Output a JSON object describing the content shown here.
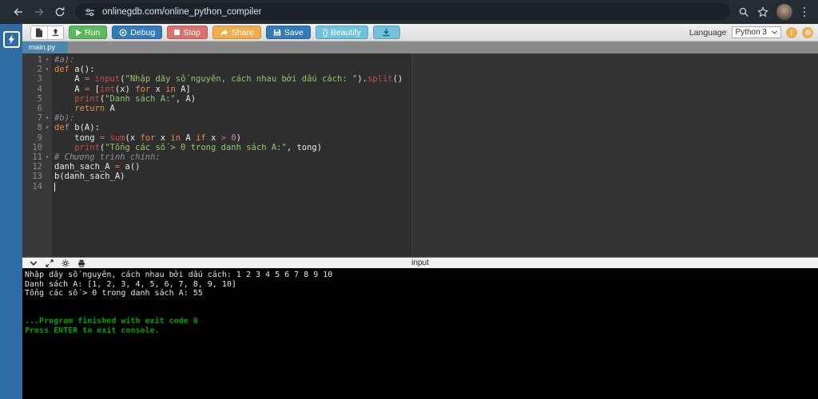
{
  "browser": {
    "url": "onlinegdb.com/online_python_compiler"
  },
  "toolbar": {
    "run_label": "Run",
    "debug_label": "Debug",
    "stop_label": "Stop",
    "share_label": "Share",
    "save_label": "Save",
    "beautify_label": "{} Beautify",
    "language_label": "Language",
    "language_value": "Python 3",
    "info_label": "i"
  },
  "tabbar": {
    "tabs": [
      {
        "label": "main.py",
        "active": true
      }
    ]
  },
  "editor": {
    "lines": [
      {
        "num": 1,
        "fold": true,
        "segments": [
          {
            "c": "com",
            "t": "#a):"
          }
        ]
      },
      {
        "num": 2,
        "fold": true,
        "segments": [
          {
            "c": "kw",
            "t": "def"
          },
          {
            "c": "pl",
            "t": " a():"
          }
        ]
      },
      {
        "num": 3,
        "segments": [
          {
            "c": "pl",
            "t": "    A "
          },
          {
            "c": "op",
            "t": "="
          },
          {
            "c": "pl",
            "t": " "
          },
          {
            "c": "fn",
            "t": "input"
          },
          {
            "c": "pl",
            "t": "("
          },
          {
            "c": "str",
            "t": "\"Nhập dãy số nguyên, cách nhau bởi dấu cách: \""
          },
          {
            "c": "pl",
            "t": ")."
          },
          {
            "c": "fn",
            "t": "split"
          },
          {
            "c": "pl",
            "t": "()"
          }
        ]
      },
      {
        "num": 4,
        "segments": [
          {
            "c": "pl",
            "t": "    A "
          },
          {
            "c": "op",
            "t": "="
          },
          {
            "c": "pl",
            "t": " ["
          },
          {
            "c": "fn",
            "t": "int"
          },
          {
            "c": "pl",
            "t": "(x) "
          },
          {
            "c": "kw",
            "t": "for"
          },
          {
            "c": "pl",
            "t": " x "
          },
          {
            "c": "kw",
            "t": "in"
          },
          {
            "c": "pl",
            "t": " A]"
          }
        ]
      },
      {
        "num": 5,
        "segments": [
          {
            "c": "pl",
            "t": "    "
          },
          {
            "c": "fn",
            "t": "print"
          },
          {
            "c": "pl",
            "t": "("
          },
          {
            "c": "str",
            "t": "\"Danh sách A:\""
          },
          {
            "c": "pl",
            "t": ", A)"
          }
        ]
      },
      {
        "num": 6,
        "segments": [
          {
            "c": "pl",
            "t": "    "
          },
          {
            "c": "kw",
            "t": "return"
          },
          {
            "c": "pl",
            "t": " A"
          }
        ]
      },
      {
        "num": 7,
        "fold": true,
        "segments": [
          {
            "c": "com",
            "t": "#b):"
          }
        ]
      },
      {
        "num": 8,
        "fold": true,
        "segments": [
          {
            "c": "kw",
            "t": "def"
          },
          {
            "c": "pl",
            "t": " b(A):"
          }
        ]
      },
      {
        "num": 9,
        "segments": [
          {
            "c": "pl",
            "t": "    tong "
          },
          {
            "c": "op",
            "t": "="
          },
          {
            "c": "pl",
            "t": " "
          },
          {
            "c": "fn",
            "t": "sum"
          },
          {
            "c": "pl",
            "t": "(x "
          },
          {
            "c": "kw",
            "t": "for"
          },
          {
            "c": "pl",
            "t": " x "
          },
          {
            "c": "kw",
            "t": "in"
          },
          {
            "c": "pl",
            "t": " A "
          },
          {
            "c": "kw",
            "t": "if"
          },
          {
            "c": "pl",
            "t": " x "
          },
          {
            "c": "op",
            "t": ">"
          },
          {
            "c": "pl",
            "t": " "
          },
          {
            "c": "num",
            "t": "0"
          },
          {
            "c": "pl",
            "t": ")"
          }
        ]
      },
      {
        "num": 10,
        "segments": [
          {
            "c": "pl",
            "t": "    "
          },
          {
            "c": "fn",
            "t": "print"
          },
          {
            "c": "pl",
            "t": "("
          },
          {
            "c": "str",
            "t": "\"Tổng các số > 0 trong danh sách A:\""
          },
          {
            "c": "pl",
            "t": ", tong)"
          }
        ]
      },
      {
        "num": 11,
        "fold": true,
        "segments": [
          {
            "c": "com",
            "t": "# Chương trình chính:"
          }
        ]
      },
      {
        "num": 12,
        "segments": [
          {
            "c": "pl",
            "t": "danh_sach_A "
          },
          {
            "c": "op",
            "t": "="
          },
          {
            "c": "pl",
            "t": " a()"
          }
        ]
      },
      {
        "num": 13,
        "segments": [
          {
            "c": "pl",
            "t": "b(danh_sach_A)"
          }
        ]
      },
      {
        "num": 14,
        "cursor": true,
        "segments": []
      }
    ]
  },
  "console": {
    "header_label": "input",
    "lines": [
      {
        "c": "out",
        "t": "Nhập dãy số nguyên, cách nhau bởi dấu cách: 1 2 3 4 5 6 7 8 9 10"
      },
      {
        "c": "out",
        "t": "Danh sách A: [1, 2, 3, 4, 5, 6, 7, 8, 9, 10]"
      },
      {
        "c": "out",
        "t": "Tổng các số > 0 trong danh sách A: 55"
      },
      {
        "c": "out",
        "t": ""
      },
      {
        "c": "out",
        "t": ""
      },
      {
        "c": "sys",
        "t": "...Program finished with exit code 0"
      },
      {
        "c": "sys",
        "t": "Press ENTER to exit console."
      }
    ]
  },
  "colors": {
    "sidebar_blue": "#2e6da4",
    "tab_blue": "#4d86ad",
    "run_green": "#5cb85c",
    "debug_save_blue": "#337ab7",
    "stop_red": "#d9716d",
    "share_orange": "#f0ad4e",
    "beautify_cyan": "#6fc3dd",
    "editor_bg": "#2e2e2e",
    "console_bg": "#000000",
    "console_system_green": "#00a400",
    "string_green": "#9cc36a",
    "keyword_orange": "#e78c45",
    "builtin_red": "#c4503f"
  }
}
